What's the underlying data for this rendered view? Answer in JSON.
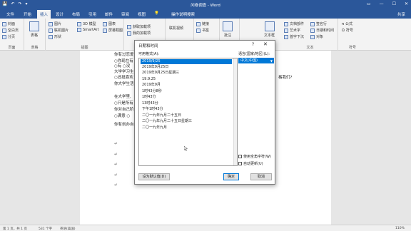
{
  "titlebar": {
    "doc_title": "问卷调查 - Word",
    "qat": [
      "💾",
      "↶",
      "↷",
      "▾"
    ],
    "window_buttons": [
      "▭",
      "—",
      "☐",
      "✕"
    ]
  },
  "tabs": [
    "文件",
    "开始",
    "插入",
    "设计",
    "布局",
    "引用",
    "邮件",
    "审阅",
    "视图"
  ],
  "active_tab": "插入",
  "tell_me": "操作说明搜索",
  "share": "共享",
  "ribbon": {
    "pages": {
      "items": [
        "封面",
        "空白页",
        "分页"
      ],
      "label": "页面"
    },
    "tables": {
      "items": [
        "表格"
      ],
      "label": "表格"
    },
    "illustrations": {
      "items": [
        "图片",
        "联机图片",
        "形状",
        "3D 模型",
        "SmartArt",
        "图表",
        "屏幕截图"
      ],
      "label": "插图"
    },
    "addins": {
      "items": [
        "获取加载项",
        "我的加载项"
      ]
    },
    "media": {
      "items": [
        "联机视频"
      ]
    },
    "links": {
      "items": [
        "链接",
        "书签"
      ]
    },
    "comments": {
      "items": [
        "批注"
      ]
    },
    "text": {
      "items": [
        "文本框",
        "文档部件",
        "艺术字",
        "首字下沉",
        "签名行",
        "日期和时间",
        "对象"
      ],
      "label": "文本"
    },
    "symbols": {
      "items": [
        "公式",
        "符号"
      ],
      "label": "符号"
    }
  },
  "document": {
    "lines": [
      "你有过恋爱",
      "○你现在有",
      "○有       ○没",
      "大学学习生",
      "○还挺喜欢",
      "你大学生活",
      "在大学里,",
      "○只是所有",
      "你对自己阶",
      "○满意       ○",
      "你有创办自"
    ],
    "right_fragment": "格我们?",
    "para_marks": [
      "↵",
      "↵",
      "↵",
      "↵",
      "↵"
    ]
  },
  "dialog": {
    "title": "日期和时间",
    "help": "?",
    "close": "✕",
    "formats_label": "可用格式(A):",
    "language_label": "语言(国家/地区)(L):",
    "language_value": "中文(中国)",
    "formats": [
      "2019/9/25",
      "2019年9月25日",
      "2019年9月25日星期三",
      "19.9.25",
      "2019年9月",
      "1时43分8秒",
      "1时43分",
      "13时43分",
      "下午1时43分",
      "二〇一九年九月二十五日",
      "二〇一九年九月二十五日星期三",
      "二〇一九年九月"
    ],
    "selected_index": 0,
    "use_fullwidth_label": "使用全角字符(W)",
    "auto_update_label": "自动更新(U)",
    "set_default_label": "设为默认值(D)",
    "ok_label": "确定",
    "cancel_label": "取消"
  },
  "statusbar": {
    "page": "第 1 页，共 1 页",
    "words": "531 个字",
    "lang": "英语(美国)",
    "zoom": "110%"
  }
}
